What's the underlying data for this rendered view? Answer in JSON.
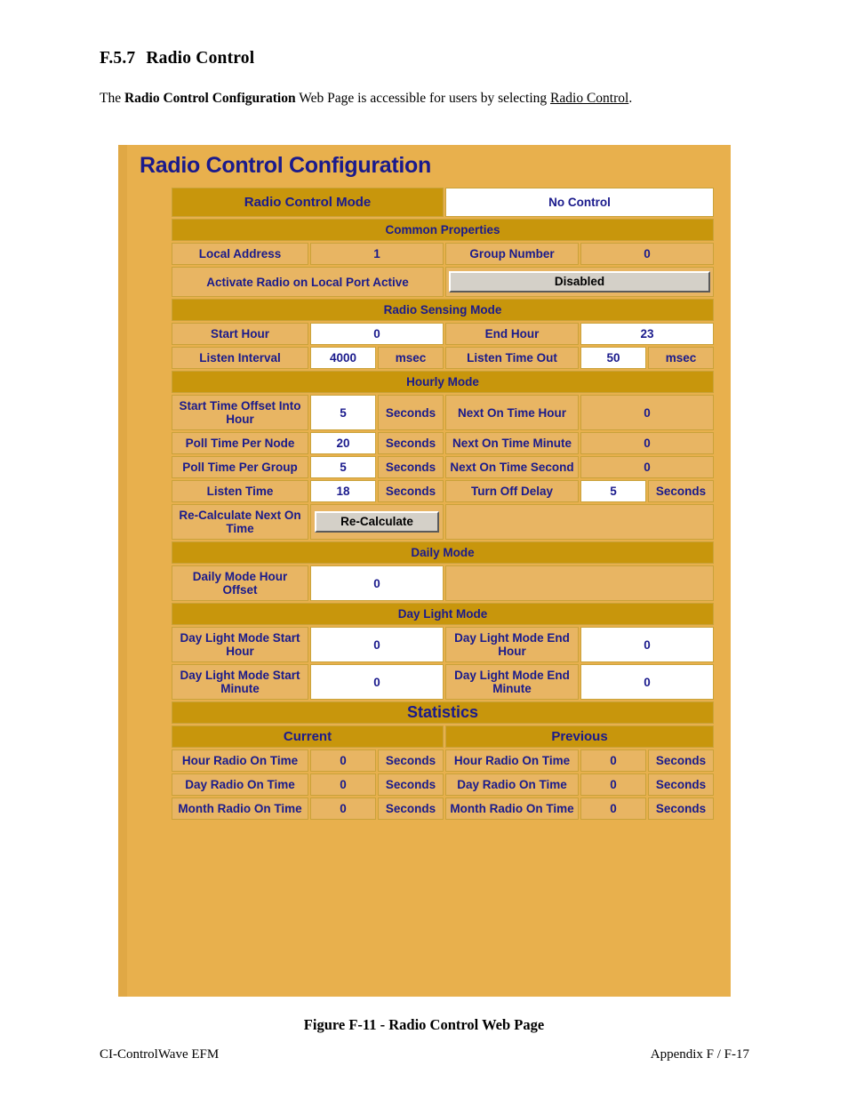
{
  "document": {
    "section_number": "F.5.7",
    "section_title": "Radio Control",
    "paragraph_pre": "The ",
    "paragraph_bold": "Radio Control Configuration",
    "paragraph_mid": " Web Page is accessible for users by selecting ",
    "paragraph_link": "Radio Control",
    "paragraph_end": ".",
    "figure_caption": "Figure F-11 - Radio Control Web Page",
    "footer_left": "CI-ControlWave EFM",
    "footer_right": "Appendix F / F-17"
  },
  "colors": {
    "page_background": "#e8b04d",
    "section_header": "#c8960c",
    "label_cell": "#e8b563",
    "input_cell": "#ffffff",
    "text_blue": "#1a1a8c",
    "border": "#c9a23a",
    "button_face": "#d4d0c8"
  },
  "web_page": {
    "title": "Radio Control Configuration",
    "radio_control_mode": {
      "label": "Radio Control Mode",
      "value": "No Control"
    },
    "common_properties": {
      "header": "Common Properties",
      "local_address": {
        "label": "Local Address",
        "value": "1"
      },
      "group_number": {
        "label": "Group Number",
        "value": "0"
      },
      "activate_radio": {
        "label": "Activate Radio on Local Port Active",
        "button_label": "Disabled"
      }
    },
    "radio_sensing_mode": {
      "header": "Radio Sensing Mode",
      "start_hour": {
        "label": "Start Hour",
        "value": "0"
      },
      "end_hour": {
        "label": "End Hour",
        "value": "23"
      },
      "listen_interval": {
        "label": "Listen Interval",
        "value": "4000",
        "unit": "msec"
      },
      "listen_time_out": {
        "label": "Listen Time Out",
        "value": "50",
        "unit": "msec"
      }
    },
    "hourly_mode": {
      "header": "Hourly Mode",
      "start_time_offset": {
        "label": "Start Time Offset Into Hour",
        "value": "5",
        "unit": "Seconds"
      },
      "next_on_time_hour": {
        "label": "Next On Time Hour",
        "value": "0"
      },
      "poll_time_per_node": {
        "label": "Poll Time Per Node",
        "value": "20",
        "unit": "Seconds"
      },
      "next_on_time_minute": {
        "label": "Next On Time Minute",
        "value": "0"
      },
      "poll_time_per_group": {
        "label": "Poll Time Per Group",
        "value": "5",
        "unit": "Seconds"
      },
      "next_on_time_second": {
        "label": "Next On Time Second",
        "value": "0"
      },
      "listen_time": {
        "label": "Listen Time",
        "value": "18",
        "unit": "Seconds"
      },
      "turn_off_delay": {
        "label": "Turn Off Delay",
        "value": "5",
        "unit": "Seconds"
      },
      "recalculate": {
        "label": "Re-Calculate Next On Time",
        "button_label": "Re-Calculate"
      }
    },
    "daily_mode": {
      "header": "Daily Mode",
      "hour_offset": {
        "label": "Daily Mode Hour Offset",
        "value": "0"
      }
    },
    "day_light_mode": {
      "header": "Day Light Mode",
      "start_hour": {
        "label": "Day Light Mode Start Hour",
        "value": "0"
      },
      "end_hour": {
        "label": "Day Light Mode End Hour",
        "value": "0"
      },
      "start_minute": {
        "label": "Day Light Mode Start Minute",
        "value": "0"
      },
      "end_minute": {
        "label": "Day Light Mode End Minute",
        "value": "0"
      }
    },
    "statistics": {
      "header": "Statistics",
      "col_current": "Current",
      "col_previous": "Previous",
      "rows": [
        {
          "current_label": "Hour Radio On Time",
          "current_value": "0",
          "current_unit": "Seconds",
          "previous_label": "Hour Radio On Time",
          "previous_value": "0",
          "previous_unit": "Seconds"
        },
        {
          "current_label": "Day Radio On Time",
          "current_value": "0",
          "current_unit": "Seconds",
          "previous_label": "Day Radio On Time",
          "previous_value": "0",
          "previous_unit": "Seconds"
        },
        {
          "current_label": "Month Radio On Time",
          "current_value": "0",
          "current_unit": "Seconds",
          "previous_label": "Month Radio On Time",
          "previous_value": "0",
          "previous_unit": "Seconds"
        }
      ]
    }
  }
}
